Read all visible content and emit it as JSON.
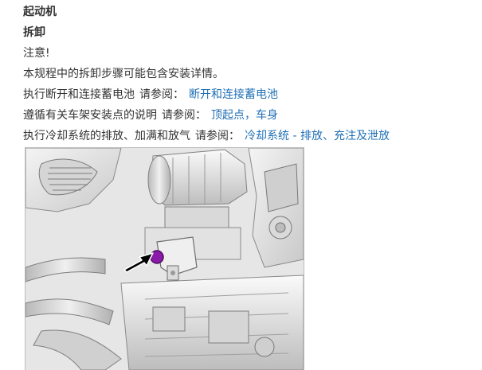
{
  "procedure": {
    "component_title": "起动机",
    "section_title": "拆卸",
    "note_label": "注意!",
    "note_text": "本规程中的拆卸步骤可能包含安装详情。",
    "steps": [
      {
        "text": "执行断开和连接蓄电池",
        "see_label": "请参阅：",
        "link_label": "断开和连接蓄电池"
      },
      {
        "text": "遵循有关车架安装点的说明",
        "see_label": "请参阅：",
        "link_label": "顶起点，车身"
      },
      {
        "text": "执行冷却系统的排放、加满和放气",
        "see_label": "请参阅：",
        "link_label": "冷却系统 - 排放、充注及泄放"
      }
    ]
  },
  "figure": {
    "depicts": "engine-starter-motor-illustration",
    "marker_color": "#8a1aa8",
    "arrow_color": "#000000",
    "link_color": "#1f6fb5"
  }
}
